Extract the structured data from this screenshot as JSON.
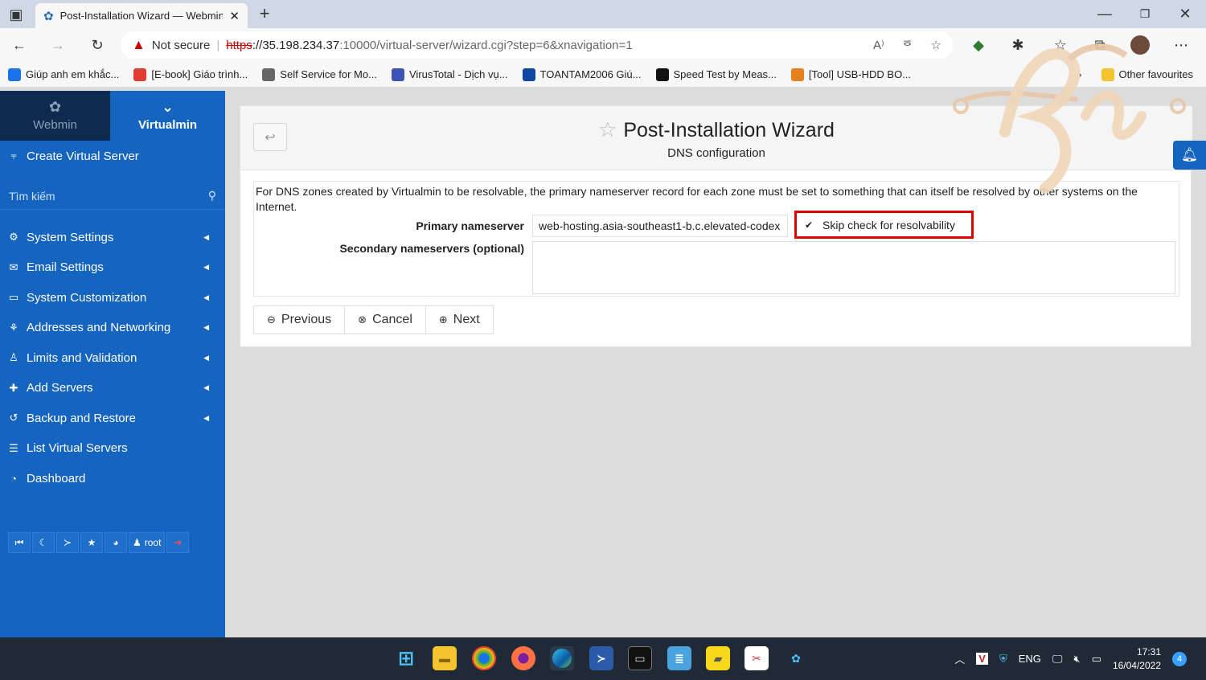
{
  "browser": {
    "tab_title": "Post-Installation Wizard — Webmin",
    "address": {
      "not_secure": "Not secure",
      "scheme": "https",
      "host": "://35.198.234.37",
      "path": ":10000/virtual-server/wizard.cgi?step=6&xnavigation=1"
    },
    "bookmarks": [
      {
        "label": "Giúp anh em khắc...",
        "icon": "blue-circle",
        "color": "#1a73e8"
      },
      {
        "label": "[E-book] Giáo trình...",
        "icon": "shield",
        "color": "#e03c31"
      },
      {
        "label": "Self Service for Mo...",
        "icon": "page",
        "color": "#666666"
      },
      {
        "label": "VirusTotal - Dịch vụ...",
        "icon": "virustotal",
        "color": "#3f51b5"
      },
      {
        "label": "TOANTAM2006 Giú...",
        "icon": "tt",
        "color": "#0d47a1"
      },
      {
        "label": "Speed Test by Meas...",
        "icon": "M",
        "color": "#111111"
      },
      {
        "label": "[Tool] USB-HDD BO...",
        "icon": "tool",
        "color": "#e67e22"
      }
    ],
    "other_favourites": "Other favourites"
  },
  "sidebar": {
    "switch_webmin": "Webmin",
    "switch_virtualmin": "Virtualmin",
    "create_label": "Create Virtual Server",
    "search_placeholder": "Tìm kiếm",
    "items": [
      {
        "label": "System Settings",
        "icon": "gear-icon",
        "glyph": "⚙",
        "caret": true
      },
      {
        "label": "Email Settings",
        "icon": "envelope-icon",
        "glyph": "✉",
        "caret": true
      },
      {
        "label": "System Customization",
        "icon": "laptop-icon",
        "glyph": "▭",
        "caret": true
      },
      {
        "label": "Addresses and Networking",
        "icon": "network-icon",
        "glyph": "⚘",
        "caret": true
      },
      {
        "label": "Limits and Validation",
        "icon": "users-icon",
        "glyph": "♙",
        "caret": true
      },
      {
        "label": "Add Servers",
        "icon": "plus-icon",
        "glyph": "✚",
        "caret": true
      },
      {
        "label": "Backup and Restore",
        "icon": "history-icon",
        "glyph": "↺",
        "caret": true
      },
      {
        "label": "List Virtual Servers",
        "icon": "list-icon",
        "glyph": "☰",
        "caret": false
      },
      {
        "label": "Dashboard",
        "icon": "dashboard-icon",
        "glyph": "◔",
        "caret": false
      }
    ],
    "bottom": {
      "user": "root"
    }
  },
  "main": {
    "title": "Post-Installation Wizard",
    "subtitle": "DNS configuration",
    "description": "For DNS zones created by Virtualmin to be resolvable, the primary nameserver record for each zone must be set to something that can itself be resolved by other systems on the Internet.",
    "primary_label": "Primary nameserver",
    "primary_value": "web-hosting.asia-southeast1-b.c.elevated-codex",
    "skip_label": "Skip check for resolvability",
    "secondary_label": "Secondary nameservers (optional)",
    "secondary_value": "",
    "buttons": {
      "previous": "Previous",
      "cancel": "Cancel",
      "next": "Next"
    }
  },
  "taskbar": {
    "lang": "ENG",
    "time": "17:31",
    "date": "16/04/2022",
    "notifications": "4"
  },
  "colors": {
    "sidebar": "#1565c0",
    "sidebar_dark": "#0d2a4f",
    "highlight": "#e00000"
  }
}
